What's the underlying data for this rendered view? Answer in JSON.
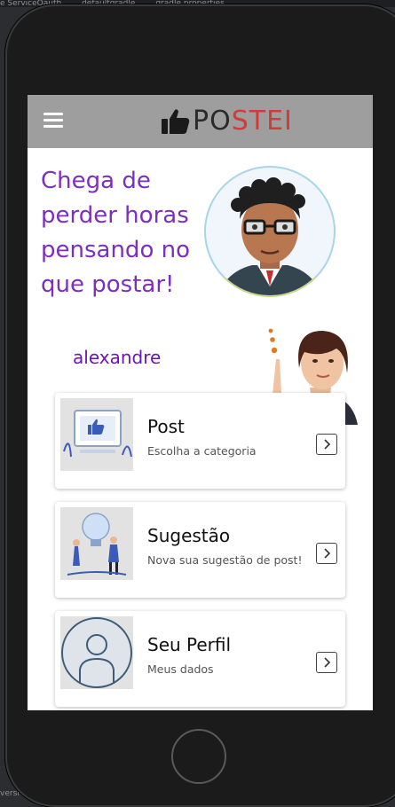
{
  "app": {
    "logo_prefix": "PO",
    "logo_accent": "STEI",
    "accent_color": "#d23b3b",
    "header_color": "#9e9e9e"
  },
  "hero": {
    "tagline": "Chega de perder horas pensando no que postar!",
    "username": "alexandre",
    "tagline_color": "#7b2fbf"
  },
  "cards": [
    {
      "title": "Post",
      "subtitle": "Escolha a categoria",
      "icon": "chevron-right-icon"
    },
    {
      "title": "Sugestão",
      "subtitle": "Nova sua sugestão de post!",
      "icon": "chevron-right-icon"
    },
    {
      "title": "Seu Perfil",
      "subtitle": "Meus dados",
      "icon": "chevron-right-icon"
    }
  ],
  "editor": {
    "tabs": [
      "e ServiceOauth",
      "defaultgradle",
      "gradle.properties"
    ],
    "footer": "versi"
  }
}
